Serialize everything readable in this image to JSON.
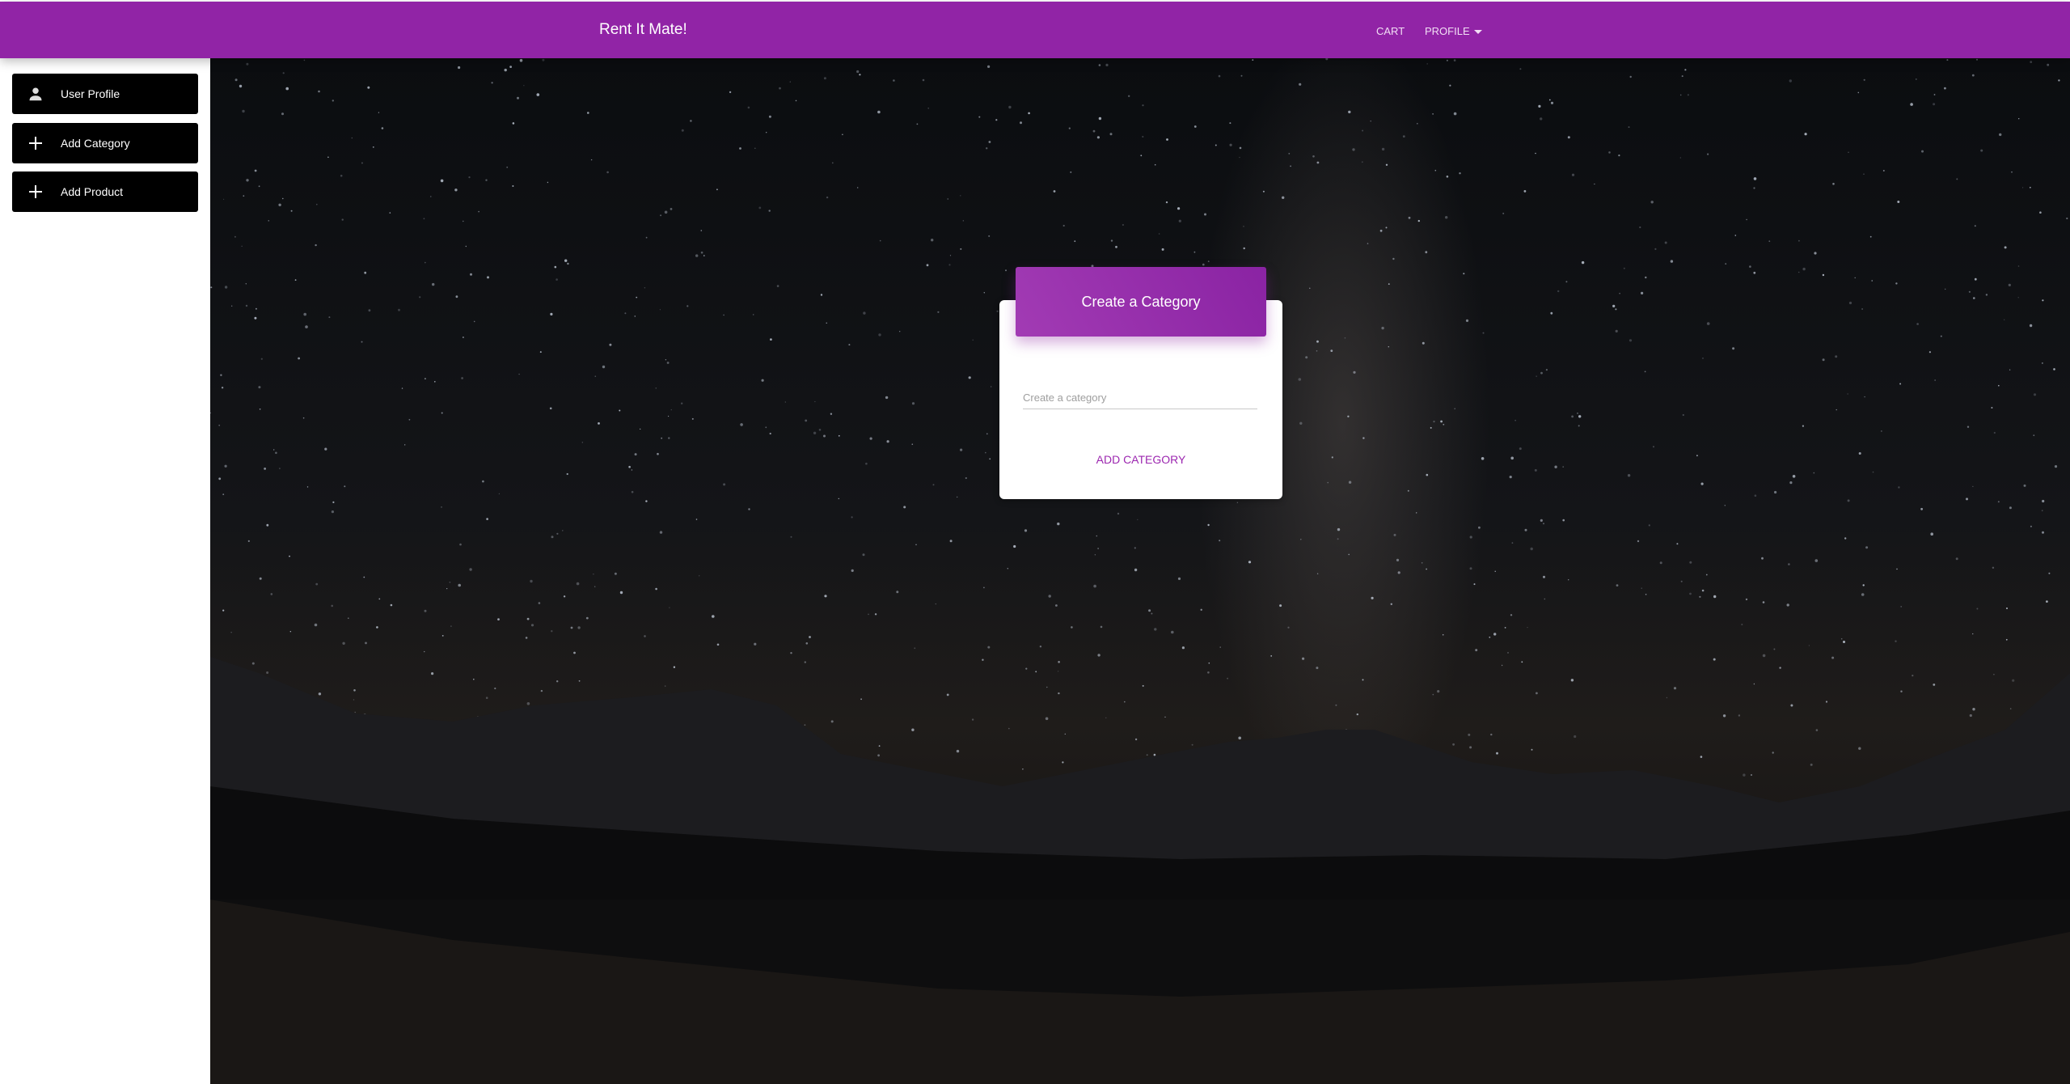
{
  "navbar": {
    "title": "Rent It Mate!",
    "cart": "CART",
    "profile": "PROFILE"
  },
  "sidebar": {
    "items": [
      {
        "label": "User Profile",
        "icon": "person-icon"
      },
      {
        "label": "Add Category",
        "icon": "plus-icon"
      },
      {
        "label": "Add Product",
        "icon": "plus-icon"
      }
    ]
  },
  "card": {
    "title": "Create a Category",
    "input_placeholder": "Create a category",
    "input_value": "",
    "submit": "ADD CATEGORY"
  },
  "colors": {
    "primary": "#9124a6",
    "sidebar_button": "#000000"
  }
}
